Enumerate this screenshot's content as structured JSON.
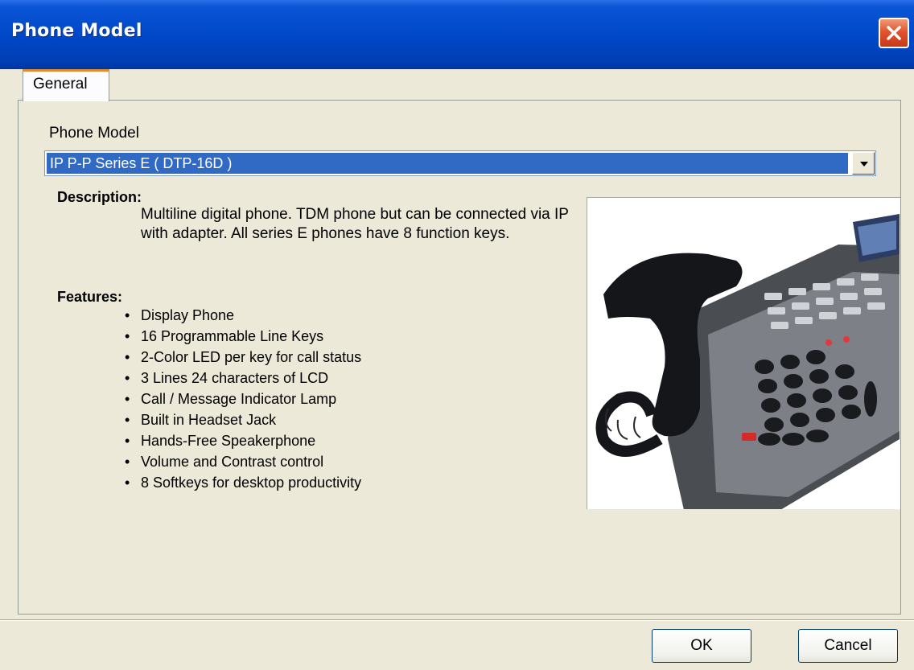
{
  "window": {
    "title": "Phone Model"
  },
  "tabs": [
    {
      "label": "General",
      "active": true
    }
  ],
  "form": {
    "phone_model_label": "Phone Model",
    "phone_model_value": "IP P-P Series E ( DTP-16D )"
  },
  "description": {
    "heading": "Description:",
    "text": "Multiline digital phone. TDM phone but can be connected via IP with adapter. All series E phones have 8 function keys."
  },
  "features": {
    "heading": "Features:",
    "items": [
      "Display Phone",
      "16 Programmable Line Keys",
      "2-Color LED per key for call status",
      "3 Lines 24 characters of LCD",
      "Call / Message Indicator Lamp",
      "Built in Headset Jack",
      "Hands-Free Speakerphone",
      "Volume and Contrast control",
      "8 Softkeys for desktop productivity"
    ]
  },
  "buttons": {
    "ok": "OK",
    "cancel": "Cancel"
  },
  "colors": {
    "titlebar": "#0048c8",
    "selection": "#316ac5",
    "dialog_bg": "#ece9d8",
    "tab_highlight": "#e68b2c",
    "close": "#e1542d"
  }
}
